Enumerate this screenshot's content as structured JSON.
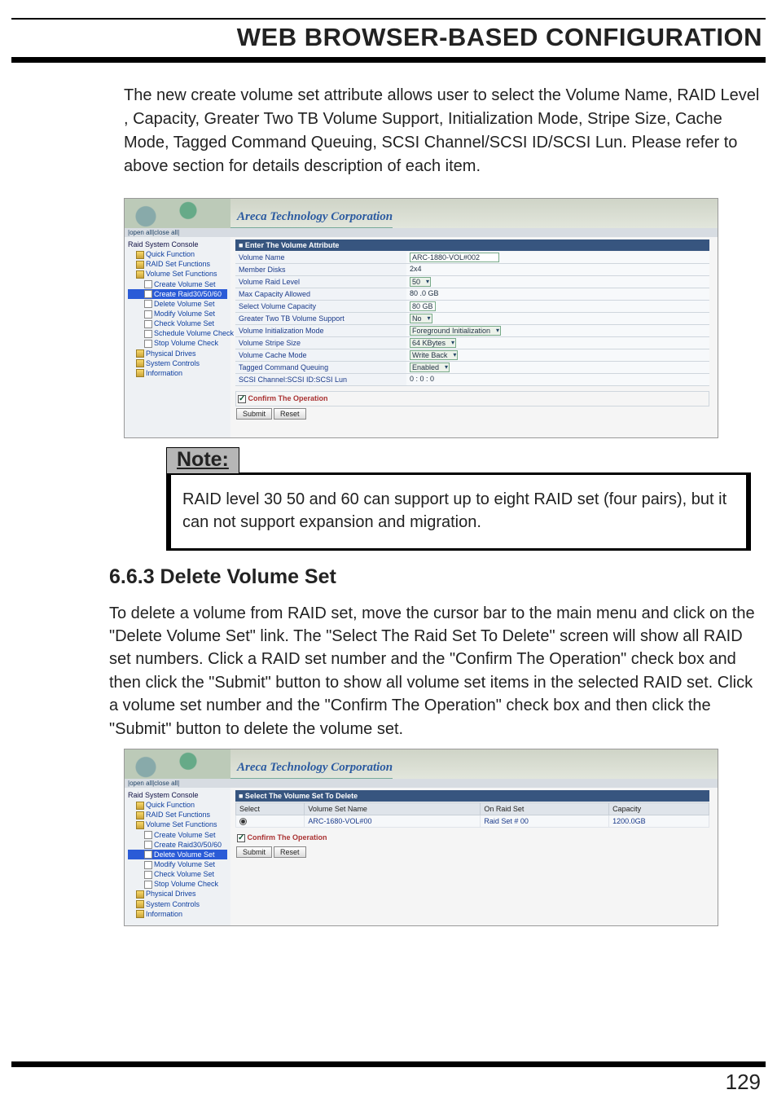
{
  "header": {
    "title": "WEB BROWSER-BASED CONFIGURATION"
  },
  "intro": "The new create volume set attribute allows user to select the Volume Name, RAID Level , Capacity, Greater Two TB Volume Support, Initialization Mode, Stripe Size, Cache Mode, Tagged Command Queuing, SCSI Channel/SCSI ID/SCSI Lun. Please refer to above section for details description of each item.",
  "shot1": {
    "corp": "Areca Technology Corporation",
    "open_close": "|open all|close all|",
    "tree": {
      "root": "Raid System Console",
      "items": [
        "Quick Function",
        "RAID Set Functions",
        "Volume Set Functions",
        "Create Volume Set",
        "Create Raid30/50/60",
        "Delete Volume Set",
        "Modify Volume Set",
        "Check Volume Set",
        "Schedule Volume Check",
        "Stop Volume Check",
        "Physical Drives",
        "System Controls",
        "Information"
      ],
      "selected": "Create Raid30/50/60"
    },
    "panel_header": "■ Enter The Volume Attribute",
    "rows": [
      {
        "label": "Volume Name",
        "value": "ARC-1880-VOL#002",
        "kind": "input"
      },
      {
        "label": "Member Disks",
        "value": "2x4",
        "kind": "text"
      },
      {
        "label": "Volume Raid Level",
        "value": "50",
        "kind": "select"
      },
      {
        "label": "Max Capacity Allowed",
        "value": "80 .0  GB",
        "kind": "text2"
      },
      {
        "label": "Select Volume Capacity",
        "value": "80       GB",
        "kind": "input2"
      },
      {
        "label": "Greater Two TB Volume Support",
        "value": "No",
        "kind": "select"
      },
      {
        "label": "Volume Initialization Mode",
        "value": "Foreground Initialization",
        "kind": "select"
      },
      {
        "label": "Volume Stripe Size",
        "value": "64  KBytes",
        "kind": "select2"
      },
      {
        "label": "Volume Cache Mode",
        "value": "Write Back",
        "kind": "select"
      },
      {
        "label": "Tagged Command Queuing",
        "value": "Enabled",
        "kind": "select"
      },
      {
        "label": "SCSI Channel:SCSI ID:SCSI Lun",
        "value": "0  :  0  :  0",
        "kind": "triple"
      }
    ],
    "confirm": "Confirm The Operation",
    "buttons": {
      "submit": "Submit",
      "reset": "Reset"
    }
  },
  "note": {
    "heading": "Note:",
    "text": "RAID level 30 50 and 60 can support up to eight RAID set (four pairs), but it can not support expansion and migration."
  },
  "section": {
    "heading": "6.6.3 Delete Volume Set"
  },
  "para2": "To delete a volume from RAID set, move the cursor bar to the main menu and click on the \"Delete Volume Set\" link. The \"Select The Raid Set To Delete\" screen will show all RAID set numbers. Click a RAID set number and the \"Confirm The Operation\" check box and then click the \"Submit\" button to show all volume set items in the selected RAID set. Click a volume set number and the \"Confirm The Operation\" check box and then click the \"Submit\" button to delete the volume set.",
  "shot2": {
    "corp": "Areca Technology Corporation",
    "open_close": "|open all|close all|",
    "tree": {
      "root": "Raid System Console",
      "items": [
        "Quick Function",
        "RAID Set Functions",
        "Volume Set Functions",
        "Create Volume Set",
        "Create Raid30/50/60",
        "Delete Volume Set",
        "Modify Volume Set",
        "Check Volume Set",
        "Stop Volume Check",
        "Physical Drives",
        "System Controls",
        "Information"
      ],
      "selected": "Delete Volume Set"
    },
    "panel_header": "■ Select The Volume Set To Delete",
    "table": {
      "headers": [
        "Select",
        "Volume Set Name",
        "On Raid Set",
        "Capacity"
      ],
      "row": {
        "name": "ARC-1680-VOL#00",
        "raidset": "Raid Set # 00",
        "capacity": "1200.0GB"
      }
    },
    "confirm": "Confirm The Operation",
    "buttons": {
      "submit": "Submit",
      "reset": "Reset"
    }
  },
  "page_number": "129"
}
